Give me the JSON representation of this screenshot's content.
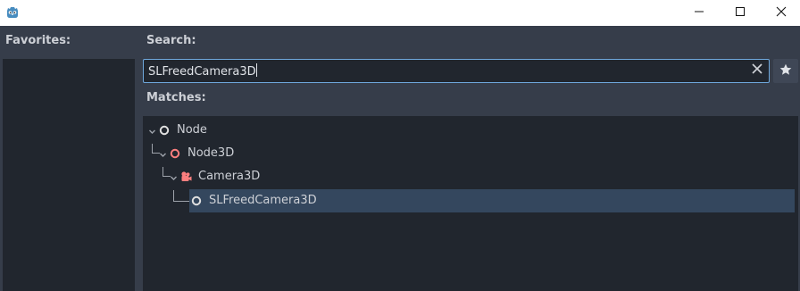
{
  "window": {
    "minimize_icon": "minimize-icon",
    "maximize_icon": "maximize-icon",
    "close_icon": "close-icon",
    "app_icon": "godot-icon"
  },
  "favorites": {
    "label": "Favorites:"
  },
  "search": {
    "label": "Search:",
    "value": "SLFreedCamera3D",
    "clear_icon": "close-icon",
    "favorite_icon": "star-icon"
  },
  "matches": {
    "label": "Matches:",
    "items": [
      {
        "name": "Node",
        "icon": "node-icon",
        "color": "#e0e0e0",
        "expanded": true,
        "depth": 0
      },
      {
        "name": "Node3D",
        "icon": "node3d-icon",
        "color": "#fc7f7f",
        "expanded": true,
        "depth": 1
      },
      {
        "name": "Camera3D",
        "icon": "camera3d-icon",
        "color": "#fc7f7f",
        "expanded": true,
        "depth": 2
      },
      {
        "name": "SLFreedCamera3D",
        "icon": "node-icon",
        "color": "#e0e0e0",
        "selected": true,
        "depth": 3
      }
    ]
  },
  "colors": {
    "panel": "#363d4a",
    "field": "#21262e",
    "accent": "#6fa8dc",
    "selection": "#34475e",
    "spatial_node": "#fc7f7f"
  }
}
